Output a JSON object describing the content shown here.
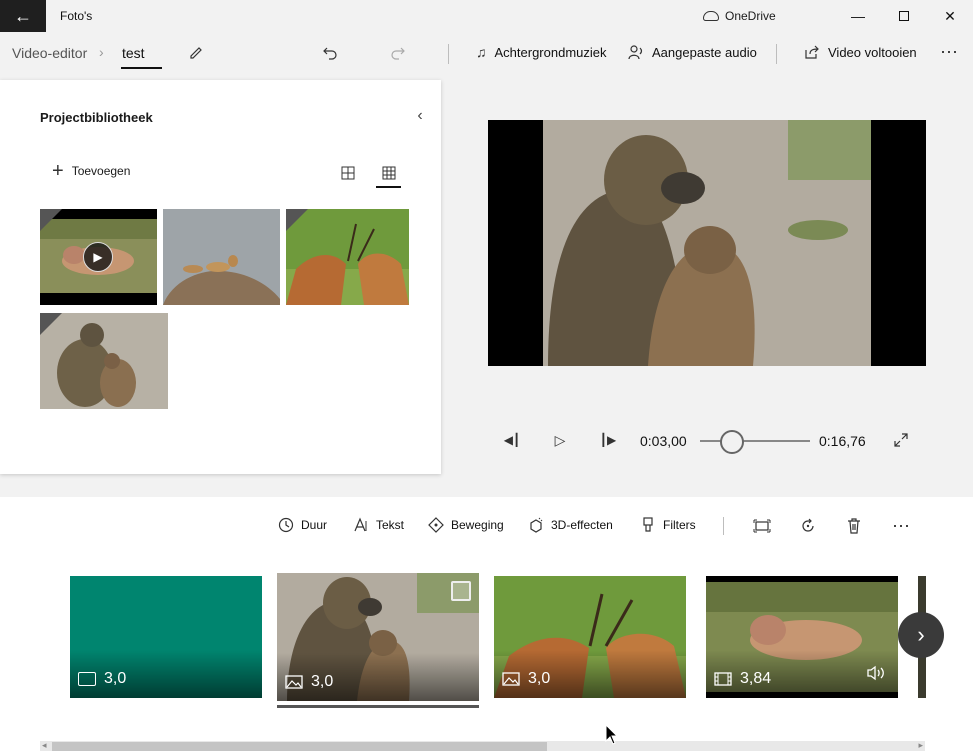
{
  "titlebar": {
    "app_title": "Foto's",
    "onedrive_label": "OneDrive"
  },
  "breadcrumb": {
    "root": "Video-editor",
    "current": "test"
  },
  "toolbar": {
    "music_label": "Achtergrondmuziek",
    "custom_audio_label": "Aangepaste audio",
    "finish_label": "Video voltooien"
  },
  "library": {
    "title": "Projectbibliotheek",
    "add_label": "Toevoegen"
  },
  "playback": {
    "current_time": "0:03,00",
    "total_time": "0:16,76",
    "progress_fraction": 0.179
  },
  "storyboard": {
    "tools": {
      "duration": "Duur",
      "text": "Tekst",
      "motion": "Beweging",
      "effects3d": "3D-effecten",
      "filters": "Filters"
    },
    "cards": [
      {
        "duration": "3,0",
        "type": "title-card",
        "color": "#00856f"
      },
      {
        "duration": "3,0",
        "type": "image",
        "selected": true
      },
      {
        "duration": "3,0",
        "type": "image"
      },
      {
        "duration": "3,84",
        "type": "video",
        "has_audio": true
      }
    ]
  },
  "colors": {
    "accent_teal": "#00856f",
    "back_button": "#1f1f1f"
  }
}
